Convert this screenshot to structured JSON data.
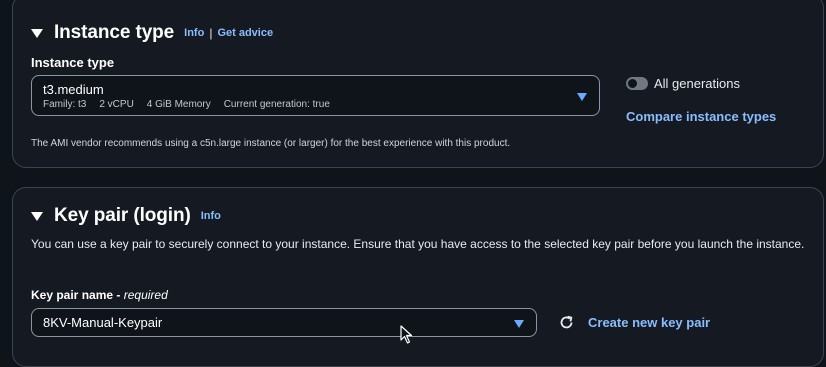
{
  "instance_type_section": {
    "title": "Instance type",
    "info_label": "Info",
    "separator": "|",
    "advice_label": "Get advice",
    "field_label": "Instance type",
    "selected": {
      "name": "t3.medium",
      "family": "Family: t3",
      "vcpu": "2 vCPU",
      "memory": "4 GiB Memory",
      "generation": "Current generation: true"
    },
    "all_generations_label": "All generations",
    "all_generations_enabled": false,
    "compare_link": "Compare instance types",
    "recommendation": "The AMI vendor recommends using a c5n.large instance (or larger) for the best experience with this product."
  },
  "key_pair_section": {
    "title": "Key pair (login)",
    "info_label": "Info",
    "description": "You can use a key pair to securely connect to your instance. Ensure that you have access to the selected key pair before you launch the instance.",
    "field_label": "Key pair name",
    "required_label": "required",
    "selected_value": "8KV-Manual-Keypair",
    "create_link": "Create new key pair"
  },
  "colors": {
    "background": "#0f141b",
    "panel": "#151a22",
    "border": "#3b4552",
    "link": "#89bdff",
    "arrow": "#6aabff"
  },
  "icons": [
    "caret-down-icon",
    "dropdown-arrow-icon",
    "refresh-icon",
    "mouse-cursor-icon"
  ]
}
